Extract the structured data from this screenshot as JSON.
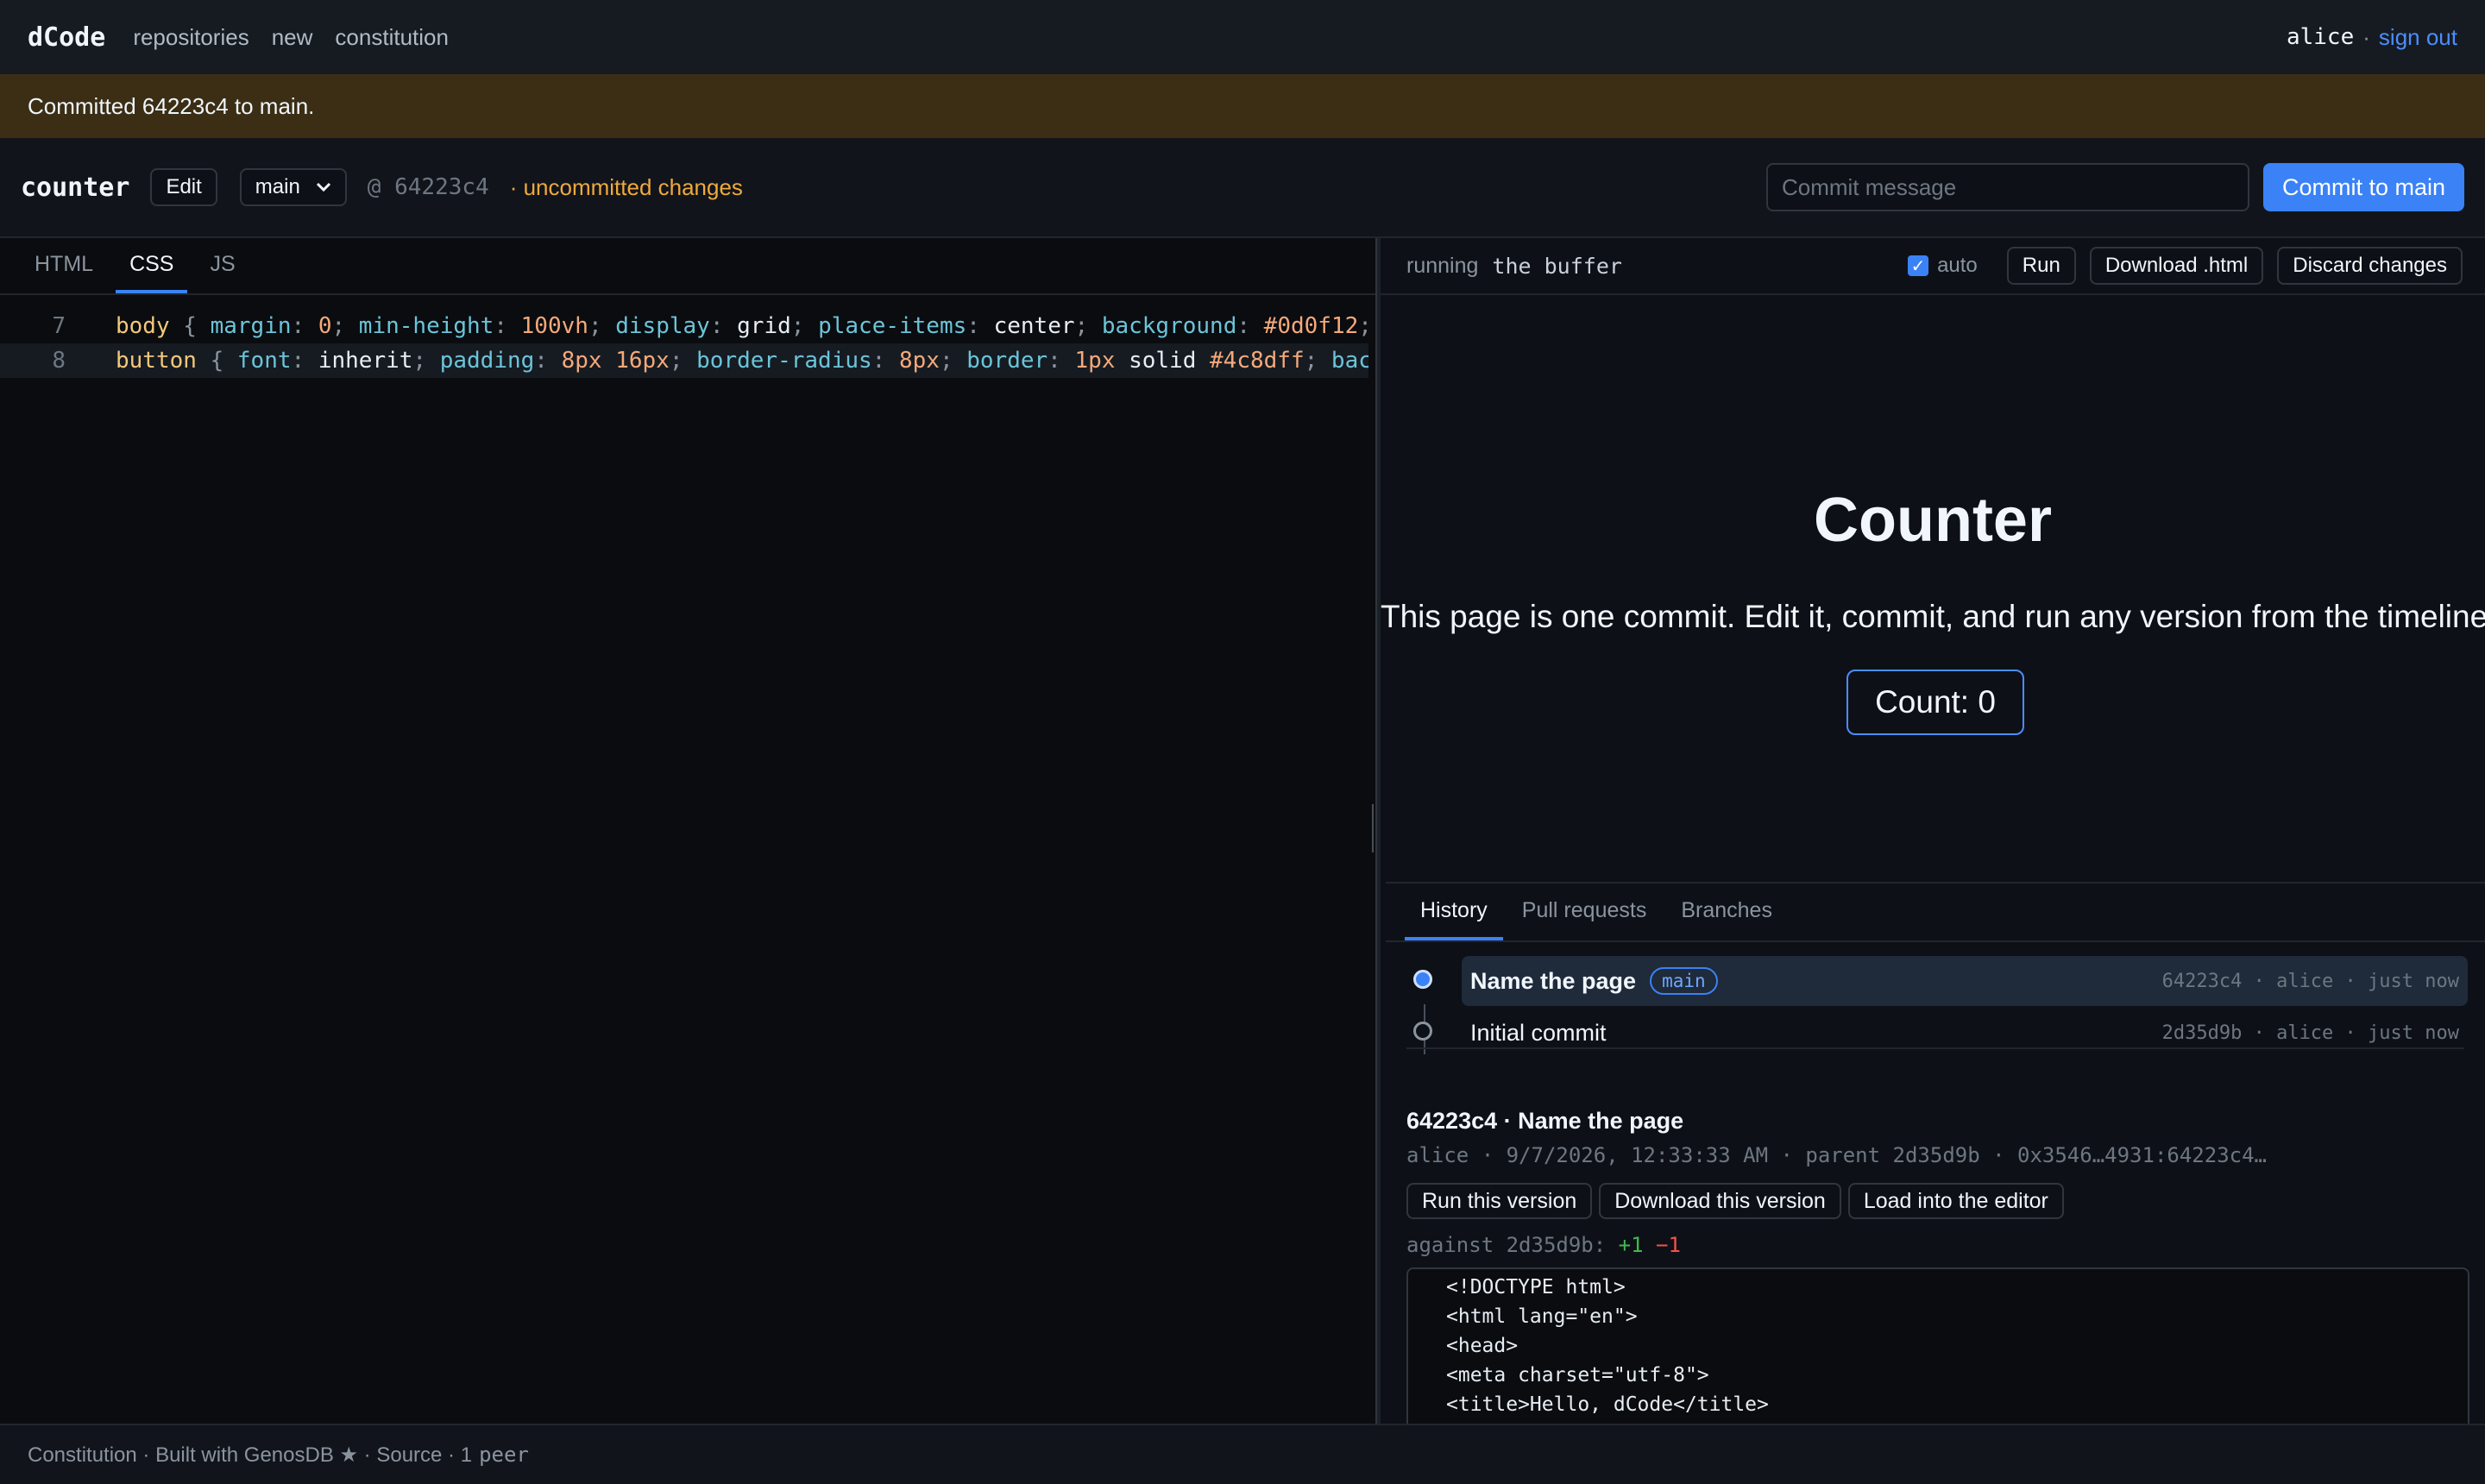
{
  "nav": {
    "brand": "dCode",
    "links": [
      "repositories",
      "new",
      "constitution"
    ],
    "user": "alice",
    "separator": "·",
    "signout": "sign out"
  },
  "flash": "Committed 64223c4 to main.",
  "repo": {
    "name": "counter",
    "edit_label": "Edit",
    "branch": "main",
    "at_commit": "@ 64223c4",
    "status": "· uncommitted changes",
    "commit_placeholder": "Commit message",
    "commit_button": "Commit to main"
  },
  "editor": {
    "tabs": [
      "HTML",
      "CSS",
      "JS"
    ],
    "active_tab": "CSS",
    "lines": [
      {
        "num": "7",
        "current": false
      },
      {
        "num": "8",
        "current": true
      }
    ]
  },
  "runbar": {
    "label": "running",
    "target": "the buffer",
    "auto_label": "auto",
    "auto_checked": true,
    "run": "Run",
    "download": "Download .html",
    "discard": "Discard changes"
  },
  "preview": {
    "title": "Counter",
    "text": "This page is one commit. Edit it, commit, and run any version from the timeline.",
    "button": "Count: 0"
  },
  "history": {
    "tabs": [
      "History",
      "Pull requests",
      "Branches"
    ],
    "active_tab": "History",
    "commits": [
      {
        "message": "Name the page",
        "badge": "main",
        "meta": "64223c4 · alice · just now",
        "selected": true
      },
      {
        "message": "Initial commit",
        "badge": "",
        "meta": "2d35d9b · alice · just now",
        "selected": false
      }
    ],
    "detail": {
      "title": "64223c4 · Name the page",
      "meta": "alice · 9/7/2026, 12:33:33 AM · parent 2d35d9b · 0x3546…4931:64223c4…",
      "buttons": [
        "Run this version",
        "Download this version",
        "Load into the editor"
      ],
      "against": "against 2d35d9b:",
      "plus": "+1",
      "minus": "−1",
      "diff_lines": [
        "<!DOCTYPE html>",
        "<html lang=\"en\">",
        "<head>",
        "<meta charset=\"utf-8\">",
        "<title>Hello, dCode</title>"
      ]
    }
  },
  "footer": {
    "text": "Constitution · Built with GenosDB ★ · Source · 1",
    "peers": "peer"
  },
  "colors": {
    "accent": "#3b82f6",
    "link": "#4c8dff",
    "warning": "#f0a93c",
    "banner": "#3b2e14",
    "add": "#3fb950",
    "remove": "#f85149"
  }
}
